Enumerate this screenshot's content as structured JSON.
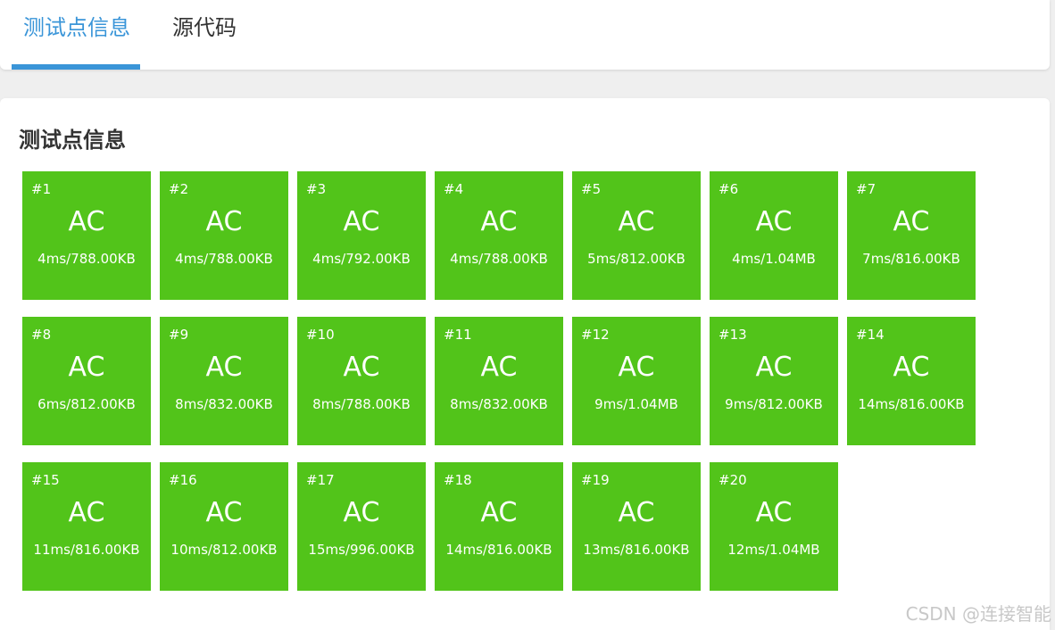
{
  "tabs": [
    {
      "label": "测试点信息",
      "active": true
    },
    {
      "label": "源代码",
      "active": false
    }
  ],
  "section_title": "测试点信息",
  "colors": {
    "accent": "#3a95d8",
    "ac_green": "#52c41a"
  },
  "test_cases": [
    {
      "id": "#1",
      "status": "AC",
      "usage": "4ms/788.00KB"
    },
    {
      "id": "#2",
      "status": "AC",
      "usage": "4ms/788.00KB"
    },
    {
      "id": "#3",
      "status": "AC",
      "usage": "4ms/792.00KB"
    },
    {
      "id": "#4",
      "status": "AC",
      "usage": "4ms/788.00KB"
    },
    {
      "id": "#5",
      "status": "AC",
      "usage": "5ms/812.00KB"
    },
    {
      "id": "#6",
      "status": "AC",
      "usage": "4ms/1.04MB"
    },
    {
      "id": "#7",
      "status": "AC",
      "usage": "7ms/816.00KB"
    },
    {
      "id": "#8",
      "status": "AC",
      "usage": "6ms/812.00KB"
    },
    {
      "id": "#9",
      "status": "AC",
      "usage": "8ms/832.00KB"
    },
    {
      "id": "#10",
      "status": "AC",
      "usage": "8ms/788.00KB"
    },
    {
      "id": "#11",
      "status": "AC",
      "usage": "8ms/832.00KB"
    },
    {
      "id": "#12",
      "status": "AC",
      "usage": "9ms/1.04MB"
    },
    {
      "id": "#13",
      "status": "AC",
      "usage": "9ms/812.00KB"
    },
    {
      "id": "#14",
      "status": "AC",
      "usage": "14ms/816.00KB"
    },
    {
      "id": "#15",
      "status": "AC",
      "usage": "11ms/816.00KB"
    },
    {
      "id": "#16",
      "status": "AC",
      "usage": "10ms/812.00KB"
    },
    {
      "id": "#17",
      "status": "AC",
      "usage": "15ms/996.00KB"
    },
    {
      "id": "#18",
      "status": "AC",
      "usage": "14ms/816.00KB"
    },
    {
      "id": "#19",
      "status": "AC",
      "usage": "13ms/816.00KB"
    },
    {
      "id": "#20",
      "status": "AC",
      "usage": "12ms/1.04MB"
    }
  ],
  "watermark": "CSDN @连接智能"
}
